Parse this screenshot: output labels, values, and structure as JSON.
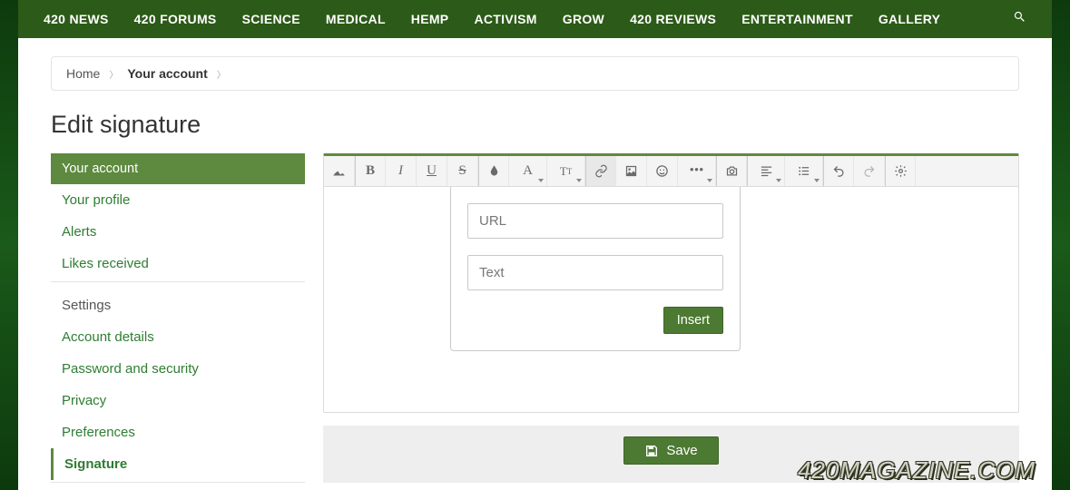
{
  "nav": {
    "items": [
      "420 NEWS",
      "420 FORUMS",
      "SCIENCE",
      "MEDICAL",
      "HEMP",
      "ACTIVISM",
      "GROW",
      "420 REVIEWS",
      "ENTERTAINMENT",
      "GALLERY"
    ]
  },
  "breadcrumb": {
    "home": "Home",
    "current": "Your account"
  },
  "page_title": "Edit signature",
  "sidebar": {
    "head": "Your account",
    "group_a": [
      "Your profile",
      "Alerts",
      "Likes received"
    ],
    "settings_label": "Settings",
    "group_b": [
      "Account details",
      "Password and security",
      "Privacy",
      "Preferences",
      "Signature"
    ],
    "active_index": 4
  },
  "toolbar": {
    "icons": [
      {
        "name": "remove-format-icon",
        "type": "sep"
      },
      {
        "name": "bold-icon"
      },
      {
        "name": "italic-icon"
      },
      {
        "name": "underline-icon"
      },
      {
        "name": "strike-icon",
        "type": "sep"
      },
      {
        "name": "color-icon"
      },
      {
        "name": "font-family-icon",
        "dd": true
      },
      {
        "name": "font-size-icon",
        "dd": true,
        "type": "sep"
      },
      {
        "name": "link-icon",
        "active": true
      },
      {
        "name": "image-icon"
      },
      {
        "name": "smile-icon"
      },
      {
        "name": "more-icon",
        "dd": true,
        "type": "sep"
      },
      {
        "name": "camera-icon",
        "type": "sep"
      },
      {
        "name": "align-icon",
        "dd": true
      },
      {
        "name": "list-icon",
        "dd": true,
        "type": "sep"
      },
      {
        "name": "undo-icon"
      },
      {
        "name": "redo-icon",
        "type": "sep"
      },
      {
        "name": "settings-icon"
      }
    ]
  },
  "link_popover": {
    "url_placeholder": "URL",
    "text_placeholder": "Text",
    "insert_label": "Insert"
  },
  "save_bar": {
    "label": "Save"
  },
  "watermark": "420MAGAZINE.COM",
  "colors": {
    "accent": "#5d8a3f",
    "nav_bg": "#2c5a18",
    "btn": "#4d7a32"
  }
}
